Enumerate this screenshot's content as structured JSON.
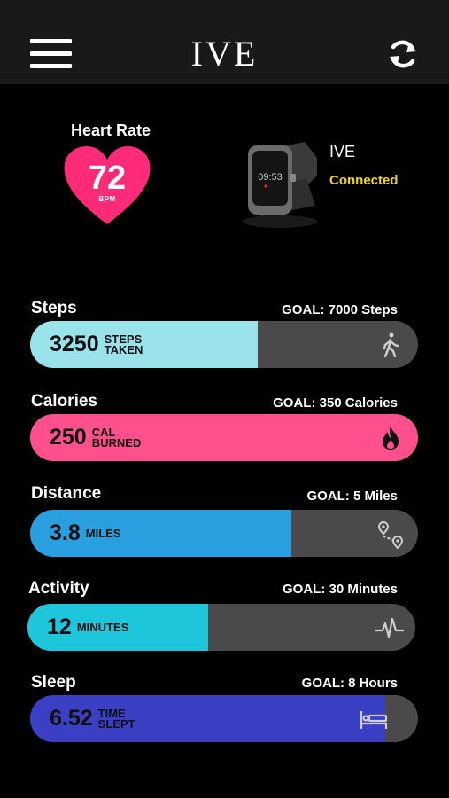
{
  "header": {
    "title": "IVE",
    "menu_icon": "hamburger-menu-icon",
    "sync_icon": "sync-icon"
  },
  "heart_rate": {
    "label": "Heart Rate",
    "value": "72",
    "unit": "BPM",
    "color": "#ff2a78"
  },
  "device": {
    "name": "IVE",
    "status": "Connected",
    "watch_time": "09:53",
    "status_color": "#f2d21f"
  },
  "metrics": [
    {
      "label": "Steps",
      "goal": "GOAL: 7000 Steps",
      "value": "3250",
      "unit_line1": "STEPS",
      "unit_line2": "TAKEN",
      "progress": 0.586,
      "color": "#9ae3ea",
      "icon": "walking-person-icon"
    },
    {
      "label": "Calories",
      "goal": "GOAL: 350 Calories",
      "value": "250",
      "unit_line1": "CAL",
      "unit_line2": "BURNED",
      "progress": 1.0,
      "color": "#ff4f8c",
      "icon": "flame-icon"
    },
    {
      "label": "Distance",
      "goal": "GOAL: 5 Miles",
      "value": "3.8",
      "unit_line1": "MILES",
      "unit_line2": "",
      "progress": 0.673,
      "color": "#2a9fe0",
      "icon": "route-map-icon"
    },
    {
      "label": "Activity",
      "goal": "GOAL: 30 Minutes",
      "value": "12",
      "unit_line1": "MINUTES",
      "unit_line2": "",
      "progress": 0.465,
      "color": "#1ec6dc",
      "icon": "activity-pulse-icon"
    },
    {
      "label": "Sleep",
      "goal": "GOAL: 8 Hours",
      "value": "6.52",
      "unit_line1": "TIME",
      "unit_line2": "SLEPT",
      "progress": 0.915,
      "color": "#3b3fc4",
      "icon": "bed-icon"
    }
  ]
}
